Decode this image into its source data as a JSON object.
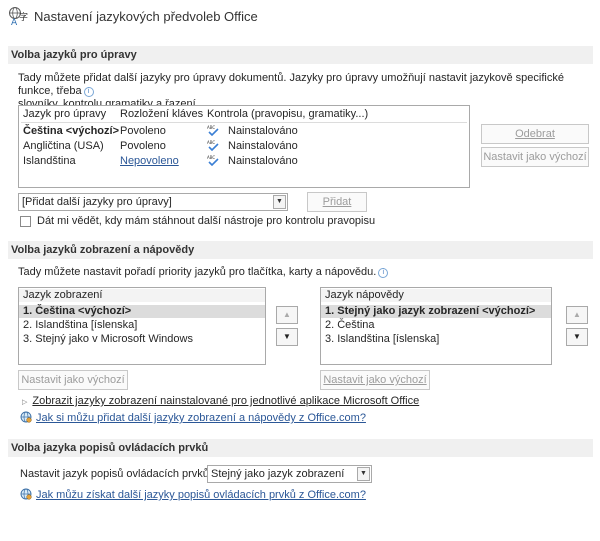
{
  "header": {
    "title": "Nastavení jazykových předvoleb Office",
    "icon": "language-settings-icon"
  },
  "editing": {
    "section_title": "Volba jazyků pro úpravy",
    "description_line1": "Tady můžete přidat další jazyky pro úpravy dokumentů. Jazyky pro úpravy umožňují nastavit jazykově specifické funkce, třeba",
    "description_line2": "slovníky, kontrolu gramatiky a řazení.",
    "columns": [
      "Jazyk pro úpravy",
      "Rozložení kláves",
      "Kontrola (pravopisu, gramatiky...)"
    ],
    "rows": [
      {
        "language": "Čeština <výchozí>",
        "keyboard": "Povoleno",
        "proofing": "Nainstalováno",
        "bold": true
      },
      {
        "language": "Angličtina (USA)",
        "keyboard": "Povoleno",
        "proofing": "Nainstalováno",
        "bold": false
      },
      {
        "language": "Islandština",
        "keyboard": "Nepovoleno",
        "proofing": "Nainstalováno",
        "bold": false
      }
    ],
    "remove_button": "Odebrat",
    "set_default_button": "Nastavit jako výchozí",
    "add_combo_value": "[Přidat další jazyky pro úpravy]",
    "add_button": "Přidat",
    "checkbox_label": "Dát mi vědět, kdy mám stáhnout další nástroje pro kontrolu pravopisu",
    "checkbox_checked": false
  },
  "display": {
    "section_title": "Volba jazyků zobrazení a nápovědy",
    "description": "Tady můžete nastavit pořadí priority jazyků pro tlačítka, karty a nápovědu.",
    "display_list_header": "Jazyk zobrazení",
    "display_items": [
      "1.  Čeština <výchozí>",
      "2.  Islandština [íslenska]",
      "3.  Stejný jako v Microsoft Windows"
    ],
    "help_list_header": "Jazyk nápovědy",
    "help_items": [
      "1.  Stejný jako jazyk zobrazení <výchozí>",
      "2.  Čeština",
      "3.  Islandština [íslenska]"
    ],
    "set_default_display": "Nastavit jako výchozí",
    "set_default_help": "Nastavit jako výchozí",
    "expand_text": "Zobrazit jazyky zobrazení nainstalované pro jednotlivé aplikace Microsoft Office",
    "link_text": "Jak si můžu přidat další jazyky zobrazení a nápovědy z Office.com?"
  },
  "screentip": {
    "section_title": "Volba jazyka popisů ovládacích prvků",
    "label": "Nastavit jazyk popisů ovládacích prvků",
    "combo_value": "Stejný jako jazyk zobrazení",
    "link_text": "Jak můžu získat další jazyky popisů ovládacích prvků z Office.com?"
  },
  "colors": {
    "section_bg": "#f0f0f0",
    "link": "#2b5797",
    "selected_row": "#dcdcdc"
  }
}
